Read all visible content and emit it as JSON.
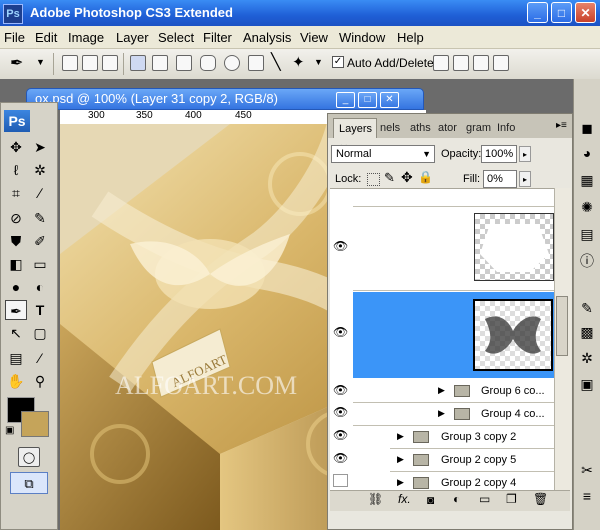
{
  "app": {
    "title": "Adobe Photoshop CS3 Extended",
    "logo": "Ps"
  },
  "window_buttons": {
    "minimize": "_",
    "maximize": "□",
    "close": "✕"
  },
  "menu": [
    "File",
    "Edit",
    "Image",
    "Layer",
    "Select",
    "Filter",
    "Analysis",
    "View",
    "Window",
    "Help"
  ],
  "options_bar": {
    "auto_add_checked": true,
    "auto_add_label": "Auto Add/Delete"
  },
  "document": {
    "title": "ox.psd @ 100% (Layer 31 copy 2, RGB/8)",
    "ruler_labels": [
      "300",
      "350",
      "400",
      "450"
    ]
  },
  "canvas": {
    "watermark": "ALFOART.COM",
    "tag_text": "ALFOART"
  },
  "toolbox": {
    "badge": "Ps"
  },
  "layers_panel": {
    "tabs": [
      "Layers",
      "nels",
      "aths",
      "ator",
      "gram",
      "Info"
    ],
    "blend_mode": "Normal",
    "opacity_label": "Opacity:",
    "opacity_value": "100%",
    "lock_label": "Lock:",
    "fill_label": "Fill:",
    "fill_value": "0%",
    "rows": [
      {
        "name": "Group 6 co..."
      },
      {
        "name": "Group 4 co..."
      },
      {
        "name": "Group 3 copy 2"
      },
      {
        "name": "Group 2 copy 5"
      },
      {
        "name": "Group 2 copy 4"
      }
    ],
    "selected_color": "#3b95f8"
  },
  "colors": {
    "foreground": "#000000",
    "background": "#c5a45a",
    "titlebar": "#1f5fd6"
  }
}
